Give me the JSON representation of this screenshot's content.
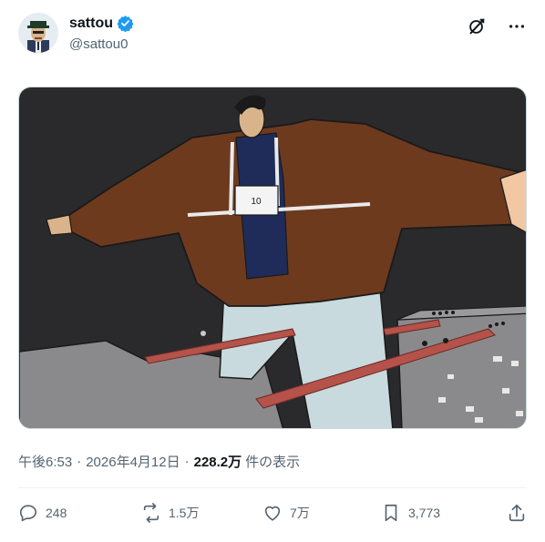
{
  "author": {
    "name": "sattou",
    "handle": "@sattou0",
    "verified": true
  },
  "header_icons": [
    "grok-icon",
    "more-icon"
  ],
  "media": {
    "bib_number": "10"
  },
  "meta": {
    "time": "午後6:53",
    "date": "2026年4月12日",
    "views_count": "228.2万",
    "views_label": "件の表示",
    "separator": "·"
  },
  "actions": {
    "replies": "248",
    "reposts": "1.5万",
    "likes": "7万",
    "bookmarks": "3,773"
  },
  "colors": {
    "accent": "#1d9bf0",
    "muted_text": "#536471",
    "primary_text": "#0f1419"
  }
}
